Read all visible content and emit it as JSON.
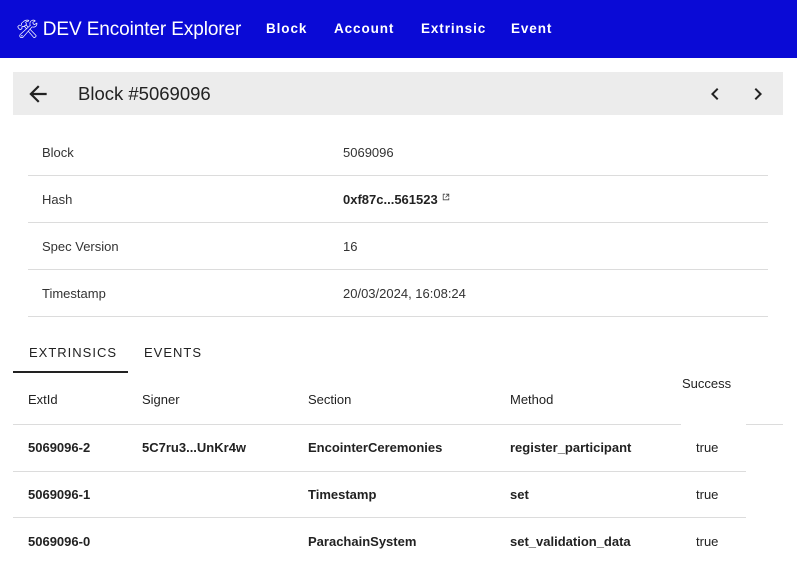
{
  "appbar": {
    "brand_icon": "🛠",
    "title": "DEV Encointer Explorer",
    "background": "#0a0ad6",
    "nav": [
      "Block",
      "Account",
      "Extrinsic",
      "Event"
    ]
  },
  "block_header": {
    "title": "Block #5069096",
    "back_icon": "arrow-left-icon",
    "prev_icon": "chevron-left-icon",
    "next_icon": "chevron-right-icon"
  },
  "details": [
    {
      "label": "Block",
      "value": "5069096"
    },
    {
      "label": "Hash",
      "value": "0xf87c...561523"
    },
    {
      "label": "Spec Version",
      "value": "16"
    },
    {
      "label": "Timestamp",
      "value": "20/03/2024, 16:08:24"
    }
  ],
  "tabs": [
    "EXTRINSICS",
    "EVENTS"
  ],
  "table": {
    "headers": [
      "ExtId",
      "Signer",
      "Section",
      "Method",
      "Success"
    ],
    "rows": [
      {
        "extid": "5069096-2",
        "signer": "5C7ru3...UnKr4w",
        "section": "EncointerCeremonies",
        "method": "register_participant",
        "success": "true"
      },
      {
        "extid": "5069096-1",
        "signer": "",
        "section": "Timestamp",
        "method": "set",
        "success": "true"
      },
      {
        "extid": "5069096-0",
        "signer": "",
        "section": "ParachainSystem",
        "method": "set_validation_data",
        "success": "true"
      }
    ]
  }
}
